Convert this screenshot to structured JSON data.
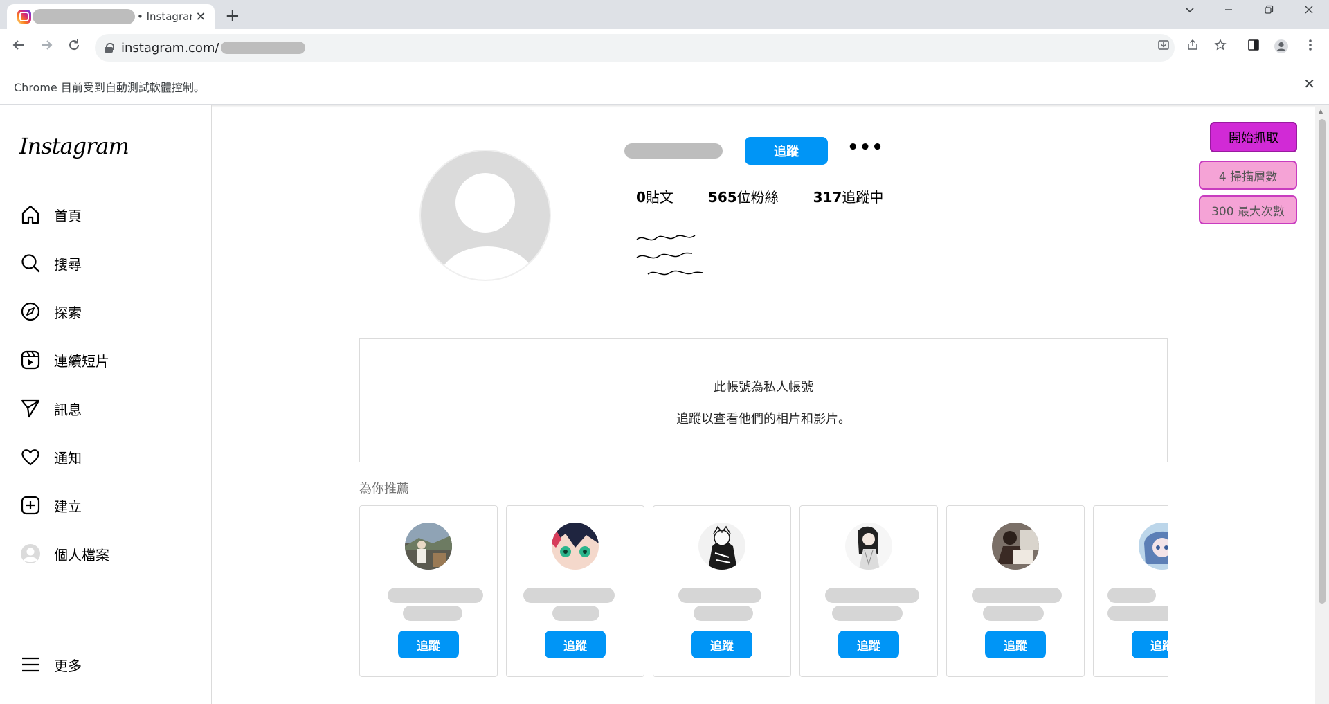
{
  "browser": {
    "tab_title": "• Instagram",
    "tab_close": "✕",
    "new_tab": "+",
    "url": "instagram.com/",
    "infobar_text": "Chrome 目前受到自動測試軟體控制。",
    "infobar_close": "✕"
  },
  "sidebar": {
    "logo": "Instagram",
    "items": [
      {
        "label": "首頁",
        "icon": "home-icon"
      },
      {
        "label": "搜尋",
        "icon": "search-icon"
      },
      {
        "label": "探索",
        "icon": "compass-icon"
      },
      {
        "label": "連續短片",
        "icon": "reels-icon"
      },
      {
        "label": "訊息",
        "icon": "send-icon"
      },
      {
        "label": "通知",
        "icon": "heart-icon"
      },
      {
        "label": "建立",
        "icon": "plus-square-icon"
      },
      {
        "label": "個人檔案",
        "icon": "avatar-icon"
      }
    ],
    "more_label": "更多"
  },
  "profile": {
    "follow_label": "追蹤",
    "more_icon": "•••",
    "posts_count": "0",
    "posts_label": "貼文",
    "followers_count": "565",
    "followers_label": "位粉絲",
    "following_count": "317",
    "following_label": "追蹤中"
  },
  "private": {
    "title": "此帳號為私人帳號",
    "subtitle": "追蹤以查看他們的相片和影片。"
  },
  "suggestions": {
    "title": "為你推薦",
    "follow_label": "追蹤",
    "count": 6
  },
  "extension": {
    "start_button": "開始抓取",
    "depth_field": "4 掃描層數",
    "max_field": "300 最大次數"
  },
  "colors": {
    "instagram_blue": "#0095f6",
    "extension_magenta": "#d12ad6",
    "extension_pink": "#f5a3d6"
  }
}
